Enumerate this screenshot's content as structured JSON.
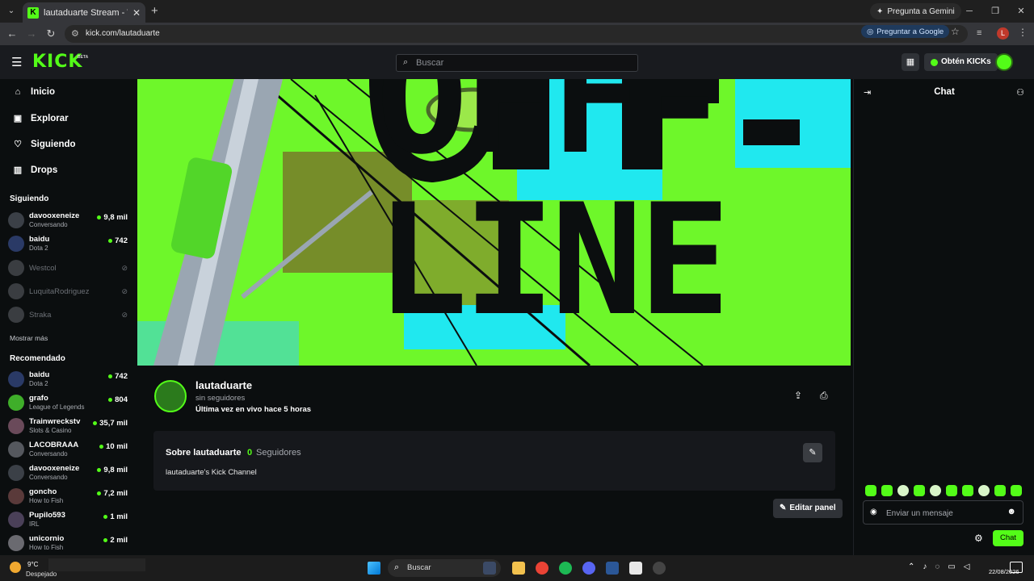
{
  "browser": {
    "tab_title": "lautaduarte Stream - Watch Live",
    "tab_close": "✕",
    "new_tab": "+",
    "gemini_label": "Pregunta a Gemini",
    "url": "kick.com/lautaduarte",
    "translate_label": "Preguntar a Google",
    "profile_initial": "L"
  },
  "header": {
    "logo": "KICK",
    "beta": "BETA",
    "search_placeholder": "Buscar",
    "kicks_label": "Obtén KICKs"
  },
  "sidebar": {
    "nav": [
      {
        "label": "Inicio",
        "icon": "home-icon"
      },
      {
        "label": "Explorar",
        "icon": "compass-icon"
      },
      {
        "label": "Siguiendo",
        "icon": "heart-icon"
      },
      {
        "label": "Drops",
        "icon": "drops-icon"
      }
    ],
    "following_title": "Siguiendo",
    "following": [
      {
        "name": "davooxeneize",
        "category": "Conversando",
        "viewers": "9,8 mil",
        "live": true
      },
      {
        "name": "baidu",
        "category": "Dota 2",
        "viewers": "742",
        "live": true
      },
      {
        "name": "Westcol",
        "category": "",
        "viewers": "",
        "live": false
      },
      {
        "name": "LuquitaRodriguez",
        "category": "",
        "viewers": "",
        "live": false
      },
      {
        "name": "Straka",
        "category": "",
        "viewers": "",
        "live": false
      }
    ],
    "show_more": "Mostrar más",
    "recommended_title": "Recomendado",
    "recommended": [
      {
        "name": "baidu",
        "category": "Dota 2",
        "viewers": "742"
      },
      {
        "name": "grafo",
        "category": "League of Legends",
        "viewers": "804"
      },
      {
        "name": "Trainwreckstv",
        "category": "Slots & Casino",
        "viewers": "35,7 mil"
      },
      {
        "name": "LACOBRAAA",
        "category": "Conversando",
        "viewers": "10 mil"
      },
      {
        "name": "davooxeneize",
        "category": "Conversando",
        "viewers": "9,8 mil"
      },
      {
        "name": "goncho",
        "category": "How to Fish",
        "viewers": "7,2 mil"
      },
      {
        "name": "Pupilo593",
        "category": "IRL",
        "viewers": "1 mil"
      },
      {
        "name": "unicornio",
        "category": "How to Fish",
        "viewers": "2 mil"
      }
    ]
  },
  "banner": {
    "line1": "OFF-",
    "line2": "LINE"
  },
  "channel": {
    "username": "lautaduarte",
    "followers_small": "sin seguidores",
    "last_live": "Última vez en vivo hace 5 horas"
  },
  "about": {
    "title": "Sobre lautaduarte",
    "count": "0",
    "followers_label": "Seguidores",
    "description": "lautaduarte's Kick Channel",
    "edit_panel": "Editar panel"
  },
  "chat": {
    "title": "Chat",
    "placeholder": "Enviar un mensaje",
    "send_label": "Chat"
  },
  "taskbar": {
    "temp": "9°C",
    "weather": "Despejado",
    "search_label": "Buscar",
    "date": "22/08/2026"
  },
  "colors": {
    "brand": "#53fc18",
    "background": "#0b0e0f",
    "header": "#191b1f"
  }
}
